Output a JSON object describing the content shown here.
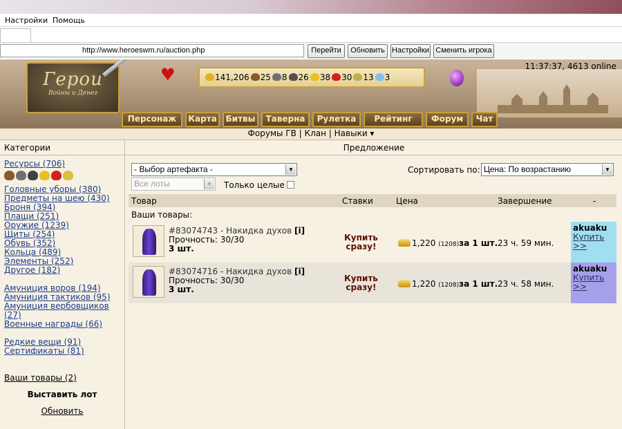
{
  "browser": {
    "menu": [
      "Настройки",
      "Помощь"
    ],
    "url": "http://www.heroeswm.ru/auction.php",
    "buttons": [
      "Перейти",
      "Обновить",
      "Настройки",
      "Сменить игрока"
    ]
  },
  "header": {
    "logo_title": "Герои",
    "logo_subtitle": "Войны и Денег",
    "clock": "11:37:37, 4613 online",
    "resources": [
      {
        "icon": "gold-icon",
        "value": "141,206",
        "color": "#e0b020"
      },
      {
        "icon": "wood-icon",
        "value": "25",
        "color": "#8b5a2b"
      },
      {
        "icon": "ore-icon",
        "value": "8",
        "color": "#707070"
      },
      {
        "icon": "mercury-icon",
        "value": "26",
        "color": "#505050"
      },
      {
        "icon": "sulfur-icon",
        "value": "38",
        "color": "#e8c020"
      },
      {
        "icon": "crystal-icon",
        "value": "30",
        "color": "#d02020"
      },
      {
        "icon": "gems-icon",
        "value": "13",
        "color": "#c0b040"
      },
      {
        "icon": "diamond-icon",
        "value": "3",
        "color": "#80c0f0"
      }
    ],
    "nav": [
      "Персонаж",
      "Карта",
      "Битвы",
      "Таверна",
      "Рулетка",
      "Рейтинг",
      "Форум",
      "Чат"
    ],
    "subnav": {
      "forums": "Форумы ГВ",
      "clan": "Клан",
      "skills": "Навыки ▾",
      "sep": "|"
    }
  },
  "left": {
    "title": "Категории",
    "resources_link": "Ресурсы (706)",
    "group1": [
      "Головные уборы (380)",
      "Предметы на шею (430)",
      "Броня (394)",
      "Плащи (251)",
      "Оружие (1239)",
      "Щиты (254)",
      "Обувь (352)",
      "Кольца (489)",
      "Элементы (252)",
      "Другое (182)"
    ],
    "group2": [
      "Амуниция воров (194)",
      "Амуниция тактиков (95)",
      "Амуниция вербовщиков (27)",
      "Военные награды (66)"
    ],
    "group3": [
      "Редкие вещи (91)",
      "Сертификаты (81)"
    ],
    "my_goods": "Ваши товары (2)",
    "post_lot": "Выставить лот",
    "refresh": "Обновить"
  },
  "right": {
    "title": "Предложение",
    "artifact_select": "- Выбор артефакта -",
    "sort_label": "Сортировать по:",
    "sort_value": "Цена: По возрастанию",
    "lots_select": "Все лоты",
    "only_whole": "Только целые",
    "columns": [
      "Товар",
      "Ставки",
      "Цена",
      "Завершение",
      "-"
    ],
    "your_goods": "Ваши товары:",
    "rows": [
      {
        "lot": "#83074743 - Накидка духов",
        "info": "[i]",
        "durability": "Прочность: 30/30",
        "qty": "3 шт.",
        "buy_now_1": "Купить",
        "buy_now_2": "сразу!",
        "price": "1,220",
        "price_small": "(1208)",
        "price_per": "за 1 шт.",
        "ends": "23 ч. 59 мин.",
        "seller": "akuaku",
        "seller_buy_1": "Купить",
        "seller_buy_2": ">>",
        "seller_bg": "#9fdff0"
      },
      {
        "lot": "#83074716 - Накидка духов",
        "info": "[i]",
        "durability": "Прочность: 30/30",
        "qty": "3 шт.",
        "buy_now_1": "Купить",
        "buy_now_2": "сразу!",
        "price": "1,220",
        "price_small": "(1208)",
        "price_per": "за 1 шт.",
        "ends": "23 ч. 58 мин.",
        "seller": "akuaku",
        "seller_buy_1": "Купить",
        "seller_buy_2": ">>",
        "seller_bg": "#a5a0ea"
      }
    ]
  }
}
